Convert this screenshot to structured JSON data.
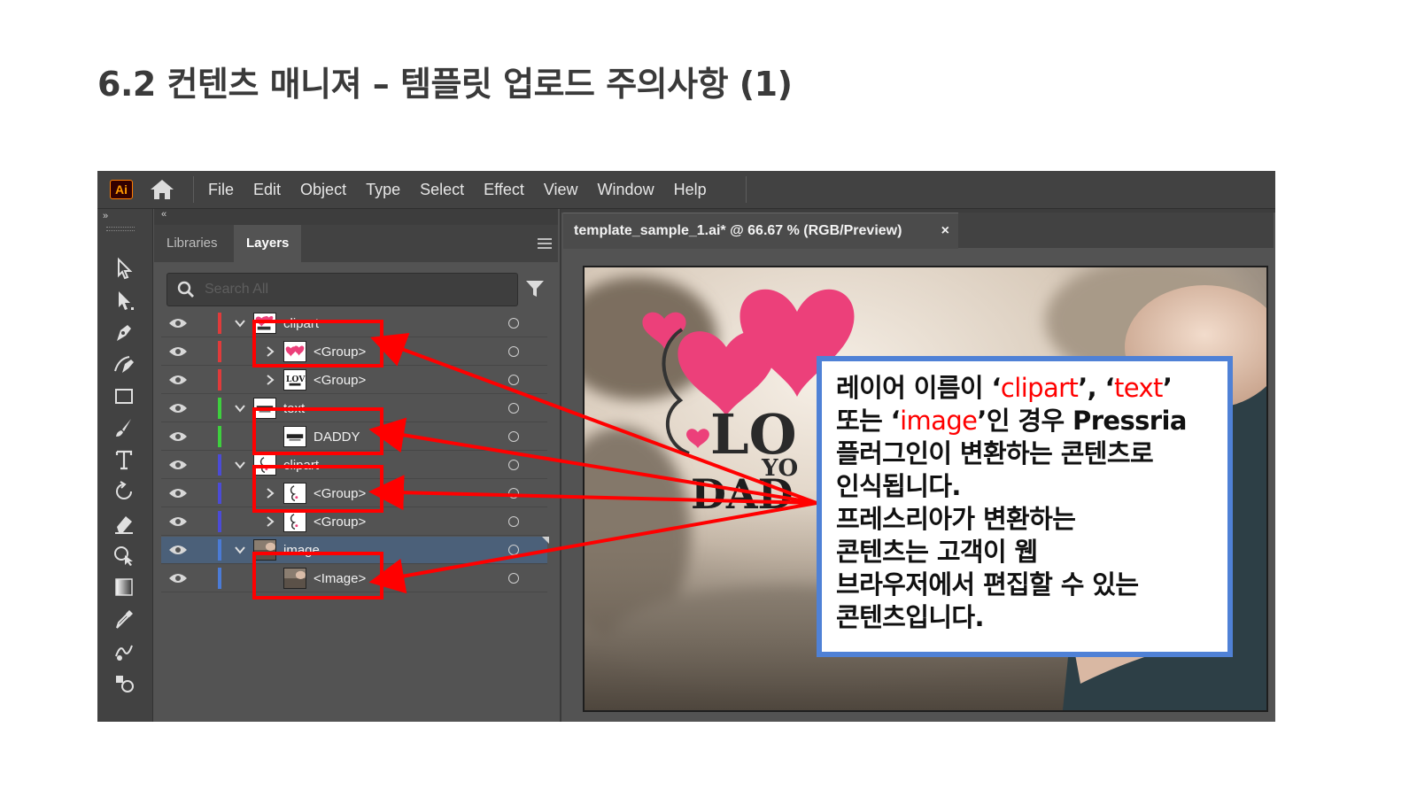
{
  "slide": {
    "title": "6.2 컨텐츠 매니져 – 템플릿 업로드 주의사항 (1)"
  },
  "app": {
    "logo_text": "Ai",
    "menu": [
      "File",
      "Edit",
      "Object",
      "Type",
      "Select",
      "Effect",
      "View",
      "Window",
      "Help"
    ],
    "collapse_left": "»",
    "collapse_right": "«"
  },
  "layers_panel": {
    "tabs": [
      "Libraries",
      "Layers"
    ],
    "active_tab": "Layers",
    "search_placeholder": "Search All",
    "rows": [
      {
        "name": "clipart",
        "level": 0,
        "expanded": true,
        "color": "#e03b3b",
        "thumb": "clipart-hearts",
        "selected": false
      },
      {
        "name": "<Group>",
        "level": 1,
        "expanded": false,
        "color": "#e03b3b",
        "thumb": "hearts",
        "selected": false
      },
      {
        "name": "<Group>",
        "level": 1,
        "expanded": false,
        "color": "#e03b3b",
        "thumb": "love-text",
        "selected": false
      },
      {
        "name": "text",
        "level": 0,
        "expanded": true,
        "color": "#3ecf3e",
        "thumb": "daddy-text",
        "selected": false
      },
      {
        "name": "DADDY",
        "level": 1,
        "expanded": null,
        "color": "#3ecf3e",
        "thumb": "daddy-text",
        "selected": false
      },
      {
        "name": "clipart",
        "level": 0,
        "expanded": true,
        "color": "#4b4bd6",
        "thumb": "swirl",
        "selected": false
      },
      {
        "name": "<Group>",
        "level": 1,
        "expanded": false,
        "color": "#4b4bd6",
        "thumb": "swirl",
        "selected": false
      },
      {
        "name": "<Group>",
        "level": 1,
        "expanded": false,
        "color": "#4b4bd6",
        "thumb": "swirl",
        "selected": false
      },
      {
        "name": "image",
        "level": 0,
        "expanded": true,
        "color": "#4b7bd6",
        "thumb": "photo",
        "selected": true
      },
      {
        "name": "<Image>",
        "level": 1,
        "expanded": null,
        "color": "#4b7bd6",
        "thumb": "photo",
        "selected": false
      }
    ]
  },
  "document": {
    "tab_title": "template_sample_1.ai* @ 66.67 % (RGB/Preview)",
    "close_glyph": "×",
    "artwork_text": {
      "love": "LO",
      "you": "YO",
      "daddy": "DAD"
    }
  },
  "callout": {
    "line1_a": "레이어 이름이 ‘",
    "kw_clipart": "clipart",
    "line1_b": "’, ‘",
    "kw_text": "text",
    "line1_c": "’",
    "line2_a": "또는 ‘",
    "kw_image": "image",
    "line2_b": "’인 경우 Pressria",
    "line3": "플러그인이 변환하는 콘텐츠로",
    "line4": "인식됩니다.",
    "line5": "프레스리아가 변환하는",
    "line6": "콘텐츠는 고객이 웹",
    "line7": "브라우저에서 편집할 수 있는",
    "line8": "콘텐츠입니다."
  },
  "colors": {
    "highlight": "#ff0000",
    "callout_border": "#4f81d6",
    "heart_pink": "#ec407a"
  }
}
